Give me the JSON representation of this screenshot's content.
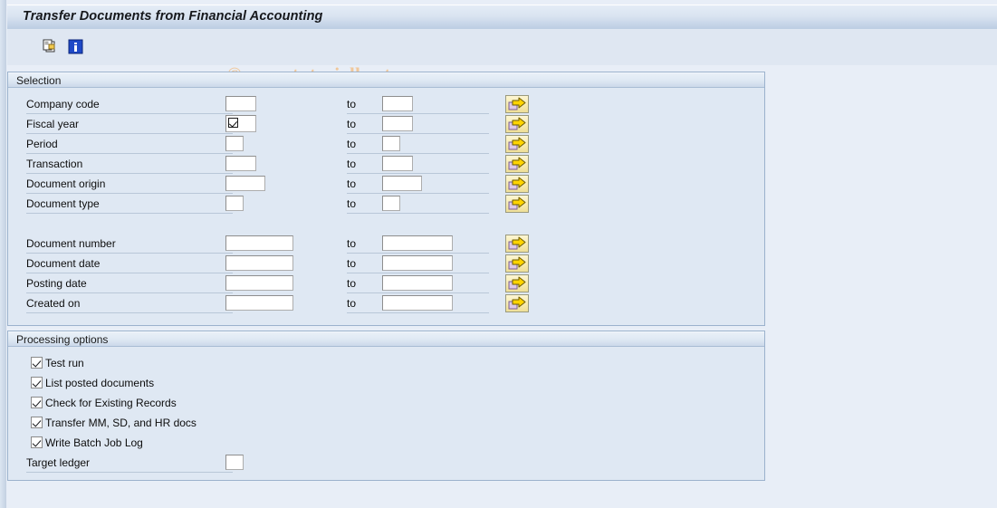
{
  "window": {
    "title": "Transfer Documents from Financial Accounting"
  },
  "watermark": {
    "text": "© www.tutorialkart.com",
    "color": "#f0c79a"
  },
  "toolbar": {
    "buttons": [
      {
        "name": "copy-selection-icon",
        "tooltip": "Multiple selection"
      },
      {
        "name": "information-icon",
        "tooltip": "Information"
      }
    ]
  },
  "selection": {
    "title": "Selection",
    "to_label": "to",
    "arrow_button_label": "Multiple selection",
    "rows": [
      {
        "label": "Company code",
        "from_value": "",
        "to_value": "",
        "from_width": 34,
        "to_width": 34,
        "has_inline_check": false
      },
      {
        "label": "Fiscal year",
        "from_value": "",
        "to_value": "",
        "from_width": 34,
        "to_width": 34,
        "has_inline_check": true
      },
      {
        "label": "Period",
        "from_value": "",
        "to_value": "",
        "from_width": 20,
        "to_width": 20,
        "has_inline_check": false
      },
      {
        "label": "Transaction",
        "from_value": "",
        "to_value": "",
        "from_width": 34,
        "to_width": 34,
        "has_inline_check": false
      },
      {
        "label": "Document origin",
        "from_value": "",
        "to_value": "",
        "from_width": 44,
        "to_width": 44,
        "has_inline_check": false
      },
      {
        "label": "Document type",
        "from_value": "",
        "to_value": "",
        "from_width": 20,
        "to_width": 20,
        "has_inline_check": false
      }
    ],
    "rows2": [
      {
        "label": "Document number",
        "from_value": "",
        "to_value": "",
        "from_width": 75,
        "to_width": 78
      },
      {
        "label": "Document date",
        "from_value": "",
        "to_value": "",
        "from_width": 75,
        "to_width": 78
      },
      {
        "label": "Posting date",
        "from_value": "",
        "to_value": "",
        "from_width": 75,
        "to_width": 78
      },
      {
        "label": "Created on",
        "from_value": "",
        "to_value": "",
        "from_width": 75,
        "to_width": 78
      }
    ]
  },
  "processing": {
    "title": "Processing options",
    "checkboxes": [
      {
        "label": "Test run",
        "checked": true
      },
      {
        "label": "List posted documents",
        "checked": true
      },
      {
        "label": "Check for Existing Records",
        "checked": true
      },
      {
        "label": "Transfer MM, SD, and HR docs",
        "checked": true
      },
      {
        "label": "Write Batch Job Log",
        "checked": true
      }
    ],
    "target_ledger": {
      "label": "Target ledger",
      "value": "",
      "width": 20
    }
  }
}
